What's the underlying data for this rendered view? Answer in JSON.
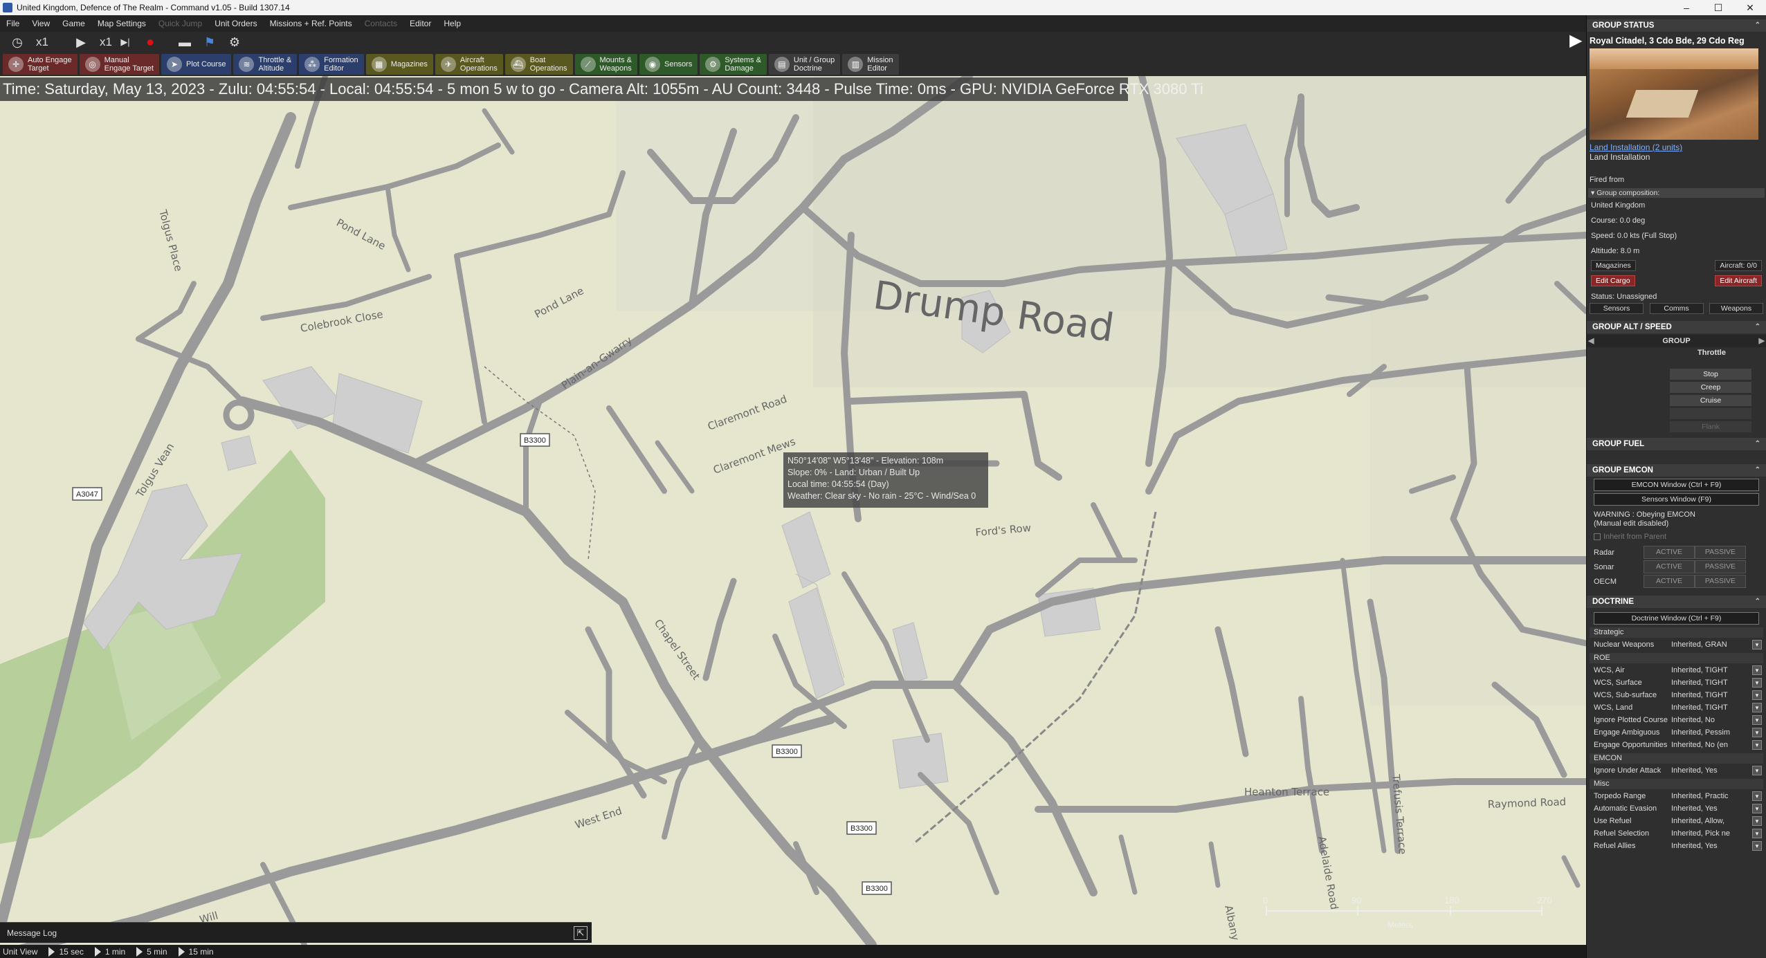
{
  "window": {
    "title": "United Kingdom, Defence of The Realm - Command v1.05 - Build 1307.14",
    "controls": [
      "–",
      "☐",
      "✕"
    ]
  },
  "menu": [
    "File",
    "View",
    "Game",
    "Map Settings",
    "Quick Jump",
    "Unit Orders",
    "Missions + Ref. Points",
    "Contacts",
    "Editor",
    "Help"
  ],
  "time_controls": {
    "speed1": "x1",
    "speed2": "x1"
  },
  "toolbar": [
    {
      "label": "Auto Engage\nTarget",
      "style": "red",
      "icon": "crosshair-icon"
    },
    {
      "label": "Manual\nEngage Target",
      "style": "red",
      "icon": "target-icon"
    },
    {
      "label": "Plot Course",
      "style": "blue",
      "icon": "course-icon"
    },
    {
      "label": "Throttle &\nAltitude",
      "style": "blue",
      "icon": "throttle-icon"
    },
    {
      "label": "Formation\nEditor",
      "style": "blue",
      "icon": "formation-icon"
    },
    {
      "label": "Magazines",
      "style": "olive",
      "icon": "magazine-icon"
    },
    {
      "label": "Aircraft\nOperations",
      "style": "olive",
      "icon": "aircraft-icon"
    },
    {
      "label": "Boat\nOperations",
      "style": "olive",
      "icon": "boat-icon"
    },
    {
      "label": "Mounts &\nWeapons",
      "style": "green",
      "icon": "weapons-icon"
    },
    {
      "label": "Sensors",
      "style": "green",
      "icon": "sensor-icon"
    },
    {
      "label": "Systems &\nDamage",
      "style": "green",
      "icon": "systems-icon"
    },
    {
      "label": "Unit / Group\nDoctrine",
      "style": "gray",
      "icon": "doctrine-icon"
    },
    {
      "label": "Mission\nEditor",
      "style": "gray",
      "icon": "mission-icon"
    }
  ],
  "status_banner": "Time: Saturday, May 13, 2023 - Zulu: 04:55:54 - Local: 04:55:54 - 5 mon 5 w to go -  Camera Alt: 1055m  - AU Count: 3448 - Pulse Time: 0ms - GPU: NVIDIA GeForce RTX 3080 Ti",
  "map_labels": {
    "drump_road": "Drump Road",
    "tolgus_place": "Tolgus Place",
    "pond_lane": "Pond Lane",
    "colebrook_close": "Colebrook Close",
    "plain_an_gwarry": "Plain-an-Gwarry",
    "claremont_road": "Claremont Road",
    "claremont_mews": "Claremont Mews",
    "tolgus_vean": "Tolgus Vean",
    "chapel_street": "Chapel Street",
    "fords_row": "Ford's Row",
    "west_end": "West End",
    "heanton_terrace": "Heanton Terrace",
    "raymond_road": "Raymond Road",
    "trefusis_terrace": "Trefusis Terrace",
    "adelaide_road": "Adelaide Road",
    "albany": "Albany",
    "will": "Will"
  },
  "road_shields": [
    "B3300",
    "A3047",
    "B3300",
    "B3300",
    "B3300"
  ],
  "tooltip": [
    "N50°14'08\" W5°13'48\" - Elevation: 108m",
    "Slope: 0% - Land: Urban / Built Up",
    "Local time: 04:55:54 (Day)",
    "Weather: Clear sky - No rain - 25°C - Wind/Sea 0"
  ],
  "scale": {
    "ticks": [
      "0",
      "90",
      "180",
      "270"
    ],
    "unit": "Meters"
  },
  "message_log": {
    "label": "Message Log"
  },
  "bottom_bar": {
    "unit_view": "Unit View",
    "steps": [
      "15 sec",
      "1 min",
      "5 min",
      "15 min"
    ]
  },
  "panel": {
    "group_status": {
      "header": "GROUP STATUS",
      "name": "Royal Citadel, 3 Cdo Bde, 29 Cdo Reg",
      "link": "Land Installation (2 units)",
      "type": "Land Installation",
      "fired_from": "Fired from",
      "composition": "Group composition:",
      "side": "United Kingdom",
      "course": "Course: 0.0 deg",
      "speed": "Speed: 0.0 kts (Full Stop)",
      "altitude": "Altitude: 8.0 m",
      "magazines_btn": "Magazines",
      "aircraft": "Aircraft: 0/0",
      "edit_cargo": "Edit Cargo",
      "edit_aircraft": "Edit Aircraft",
      "status": "Status: Unassigned",
      "tabs": [
        "Sensors",
        "Comms",
        "Weapons"
      ]
    },
    "group_alt": {
      "header": "GROUP ALT / SPEED",
      "group": "GROUP",
      "throttle": "Throttle",
      "buttons": [
        "Stop",
        "Creep",
        "Cruise",
        "",
        "Flank"
      ]
    },
    "group_fuel": {
      "header": "GROUP FUEL"
    },
    "group_emcon": {
      "header": "GROUP EMCON",
      "emcon_window": "EMCON Window (Ctrl + F9)",
      "sensors_window": "Sensors Window (F9)",
      "warning": "WARNING : Obeying EMCON",
      "warning2": "(Manual edit disabled)",
      "inherit": "Inherit from Parent",
      "rows": [
        {
          "name": "Radar",
          "a": "ACTIVE",
          "p": "PASSIVE"
        },
        {
          "name": "Sonar",
          "a": "ACTIVE",
          "p": "PASSIVE"
        },
        {
          "name": "OECM",
          "a": "ACTIVE",
          "p": "PASSIVE"
        }
      ]
    },
    "doctrine": {
      "header": "DOCTRINE",
      "window_btn": "Doctrine Window (Ctrl + F9)",
      "sections": [
        {
          "title": "Strategic",
          "rows": [
            {
              "k": "Nuclear Weapons",
              "v": "Inherited, GRAN"
            }
          ]
        },
        {
          "title": "ROE",
          "rows": [
            {
              "k": "WCS, Air",
              "v": "Inherited, TIGHT"
            },
            {
              "k": "WCS, Surface",
              "v": "Inherited, TIGHT"
            },
            {
              "k": "WCS, Sub-surface",
              "v": "Inherited, TIGHT"
            },
            {
              "k": "WCS, Land",
              "v": "Inherited, TIGHT"
            },
            {
              "k": "Ignore Plotted Course",
              "v": "Inherited, No"
            },
            {
              "k": "Engage Ambiguous",
              "v": "Inherited, Pessim"
            },
            {
              "k": "Engage Opportunities",
              "v": "Inherited, No (en"
            }
          ]
        },
        {
          "title": "EMCON",
          "rows": [
            {
              "k": "Ignore Under Attack",
              "v": "Inherited, Yes"
            }
          ]
        },
        {
          "title": "Misc",
          "rows": [
            {
              "k": "Torpedo Range",
              "v": "Inherited, Practic"
            },
            {
              "k": "Automatic Evasion",
              "v": "Inherited, Yes"
            },
            {
              "k": "Use Refuel",
              "v": "Inherited, Allow,"
            },
            {
              "k": "Refuel Selection",
              "v": "Inherited, Pick ne"
            },
            {
              "k": "Refuel Allies",
              "v": "Inherited, Yes"
            }
          ]
        }
      ]
    }
  },
  "colors": {
    "map_bg": "#e6e6cf",
    "road": "#9a9a9a",
    "park": "#b7cf9a",
    "building": "#cfcfcf"
  }
}
